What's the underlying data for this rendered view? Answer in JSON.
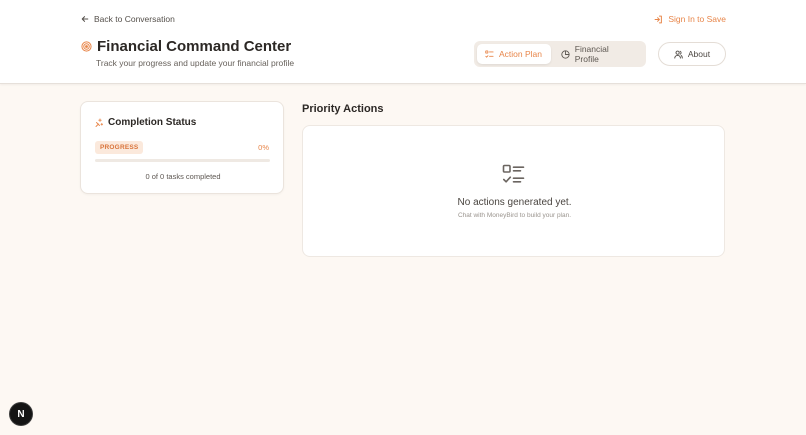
{
  "header": {
    "back_label": "Back to Conversation",
    "signin_label": "Sign In to Save",
    "title": "Financial Command Center",
    "subtitle": "Track your progress and update your financial profile",
    "tabs": [
      {
        "label": "Action Plan",
        "active": true,
        "icon": "list-check-icon"
      },
      {
        "label": "Financial Profile",
        "active": false,
        "icon": "pie-chart-icon"
      }
    ],
    "about_label": "About",
    "title_icon": "target-icon",
    "accent_color": "#e8864a"
  },
  "completion": {
    "title": "Completion Status",
    "icon": "sparkle-icon",
    "badge": "PROGRESS",
    "percent_label": "0%",
    "progress": 0,
    "tasks_text": "0 of 0 tasks completed"
  },
  "priority": {
    "title": "Priority Actions",
    "empty_icon": "checklist-icon",
    "empty_title": "No actions generated yet.",
    "empty_subtitle": "Chat with MoneyBird to build your plan."
  },
  "fab": {
    "label": "N"
  }
}
